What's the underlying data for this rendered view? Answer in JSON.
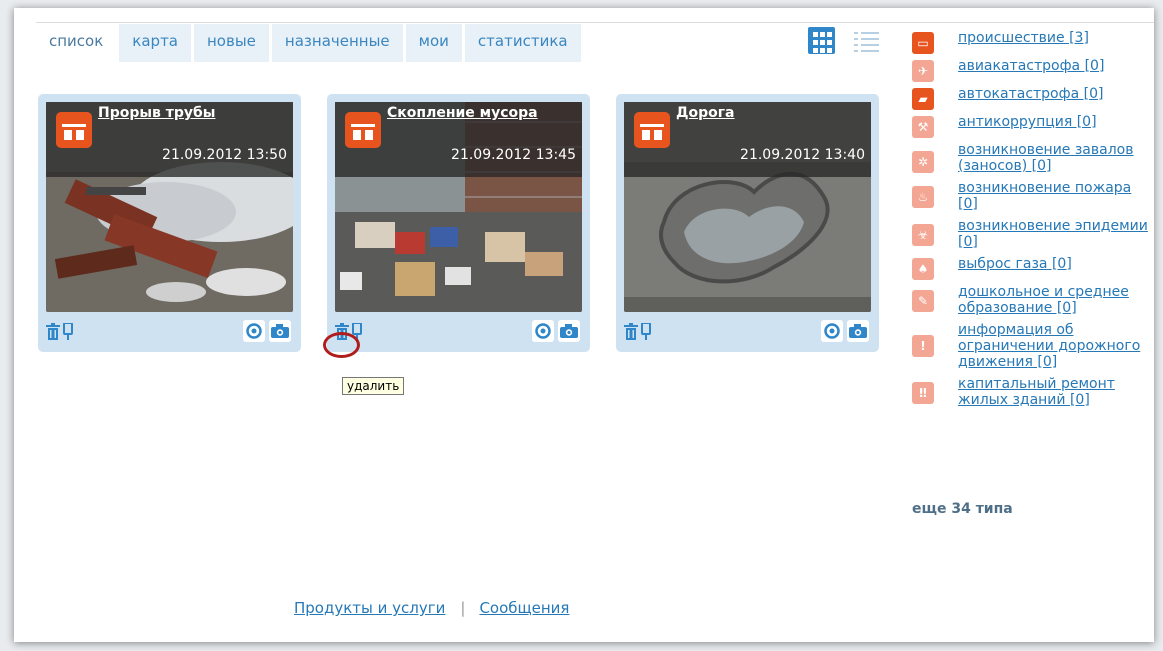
{
  "tabs": [
    {
      "label": "список",
      "active": true
    },
    {
      "label": "карта"
    },
    {
      "label": "новые"
    },
    {
      "label": "назначенные"
    },
    {
      "label": "мои"
    },
    {
      "label": "статистика"
    }
  ],
  "view_toggle": {
    "grid_icon": "grid-view-icon",
    "list_icon": "list-view-icon",
    "active": "grid"
  },
  "cards": [
    {
      "title": "Прорыв трубы",
      "date": "21.09.2012 13:50",
      "category_icon": "incident-icon"
    },
    {
      "title": "Скопление мусора",
      "date": "21.09.2012 13:45",
      "category_icon": "incident-icon"
    },
    {
      "title": "Дорога",
      "date": "21.09.2012 13:40",
      "category_icon": "incident-icon"
    }
  ],
  "tooltip": {
    "text": "удалить"
  },
  "categories": [
    {
      "label": "происшествие [3]",
      "icon": "incident-icon"
    },
    {
      "label": "авиакатастрофа [0]",
      "icon": "plane-crash-icon"
    },
    {
      "label": "автокатастрофа [0]",
      "icon": "car-crash-icon"
    },
    {
      "label": "антикоррупция [0]",
      "icon": "gavel-icon"
    },
    {
      "label": "возникновение завалов (заносов) [0]",
      "icon": "blockage-icon"
    },
    {
      "label": "возникновение пожара [0]",
      "icon": "fire-icon"
    },
    {
      "label": "возникновение эпидемии [0]",
      "icon": "biohazard-icon"
    },
    {
      "label": "выброс газа [0]",
      "icon": "gas-icon"
    },
    {
      "label": "дошкольное и среднее образование [0]",
      "icon": "education-icon"
    },
    {
      "label": "информация об ограничении дорожного движения [0]",
      "icon": "traffic-restriction-icon"
    },
    {
      "label": "капитальный ремонт жилых зданий [0]",
      "icon": "building-repair-icon"
    }
  ],
  "more_types": "еще 34 типа",
  "footer": {
    "products": "Продукты и услуги",
    "separator": "|",
    "messages": "Сообщения"
  },
  "colors": {
    "accent": "#2678b6",
    "card_bg": "#cfe2f2",
    "category_orange": "#e8541d",
    "highlight_ring": "#b01d1d"
  }
}
